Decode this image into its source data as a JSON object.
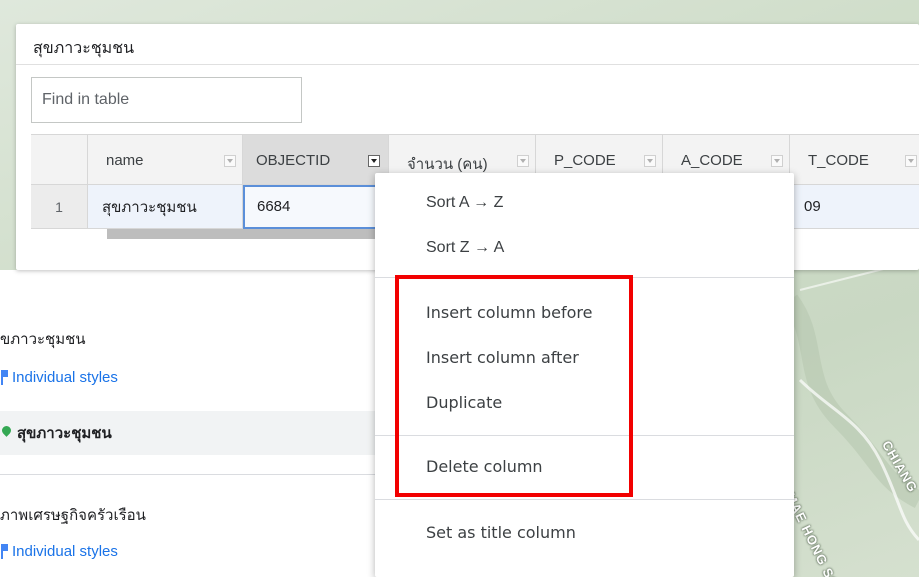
{
  "map": {
    "labels": [
      "MAE HONG SO",
      "CHIANG"
    ]
  },
  "layers": {
    "items": [
      {
        "title": "ขภาวะชุมชน",
        "link": "Individual styles",
        "sublayer": "สุขภาวะชุมชน"
      },
      {
        "title": "ภาพเศรษฐกิจครัวเรือน",
        "link": "Individual styles"
      }
    ]
  },
  "table": {
    "title": "สุขภาวะชุมชน",
    "search_placeholder": "Find in table",
    "columns": [
      "name",
      "OBJECTID",
      "จำนวน (คน)",
      "P_CODE",
      "A_CODE",
      "T_CODE"
    ],
    "rows": [
      {
        "num": "1",
        "cells": [
          "สุขภาวะชุมชน",
          "6684",
          "",
          "",
          "",
          "09"
        ]
      }
    ]
  },
  "context_menu": {
    "items": [
      "Sort A → Z",
      "Sort Z → A",
      "Insert column before",
      "Insert column after",
      "Duplicate",
      "Delete column",
      "Set as title column"
    ]
  },
  "colors": {
    "highlight_box": "#f20000",
    "link": "#1a73e8",
    "selected_cell_border": "#5b8fd9"
  }
}
